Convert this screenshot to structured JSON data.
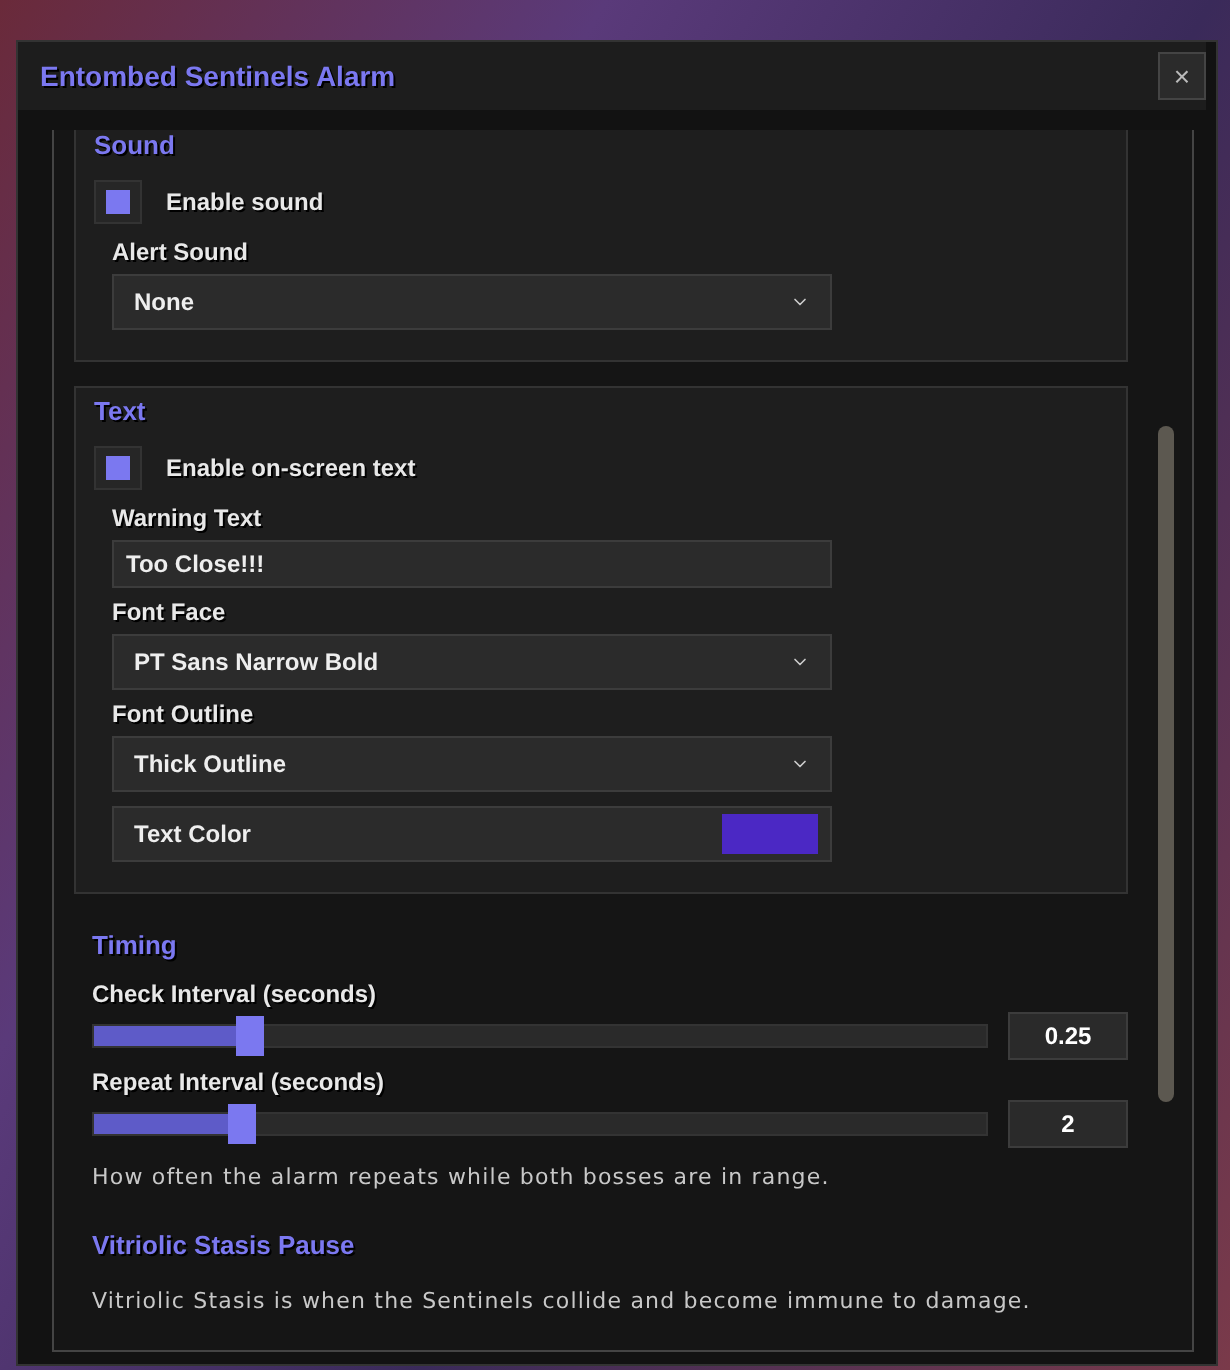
{
  "window": {
    "title": "Entombed Sentinels Alarm",
    "close": "×"
  },
  "sections": [
    {
      "kind": "group",
      "title": "Sound",
      "controls": [
        {
          "kind": "checkbox",
          "label": "Enable sound",
          "checked": true
        },
        {
          "kind": "dropdown",
          "label": "Alert Sound",
          "value": "None"
        }
      ]
    },
    {
      "kind": "group",
      "title": "Text",
      "controls": [
        {
          "kind": "checkbox",
          "label": "Enable on-screen text",
          "checked": true
        },
        {
          "kind": "input",
          "label": "Warning Text",
          "value": "Too Close!!!"
        },
        {
          "kind": "dropdown",
          "label": "Font Face",
          "value": "PT Sans Narrow Bold"
        },
        {
          "kind": "dropdown",
          "label": "Font Outline",
          "value": "Thick Outline"
        },
        {
          "kind": "color",
          "label": "Text Color",
          "color": "#4b28c4"
        }
      ]
    },
    {
      "kind": "plain",
      "title": "Timing",
      "controls": [
        {
          "kind": "slider",
          "label": "Check Interval (seconds)",
          "level": 0.175,
          "reading": "0.25"
        },
        {
          "kind": "slider",
          "label": "Repeat Interval (seconds)",
          "level": 0.166,
          "reading": "2"
        },
        {
          "kind": "note",
          "text": "How often the alarm repeats while both bosses are in range."
        }
      ]
    },
    {
      "kind": "plain",
      "title": "Vitriolic Stasis Pause",
      "controls": [
        {
          "kind": "note",
          "text": "Vitriolic Stasis is when the Sentinels collide and become immune to damage."
        }
      ]
    }
  ]
}
